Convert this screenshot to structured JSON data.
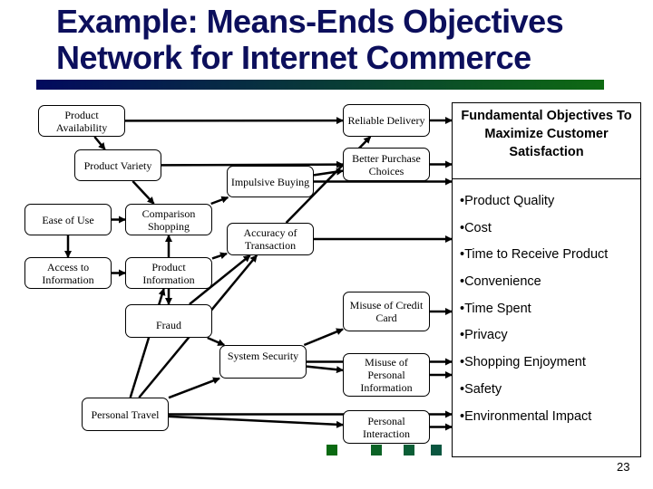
{
  "slide": {
    "title_line1": "Example: Means-Ends Objectives",
    "title_line2": "Network for Internet Commerce",
    "page_number": "23",
    "colors": {
      "title": "#0c0f5c",
      "bar_start": "#020a5e",
      "bar_end": "#0e6a12"
    }
  },
  "nodes": {
    "product_availability": "Product Availability",
    "product_variety": "Product Variety",
    "ease_of_use": "Ease of Use",
    "comparison_shopping": "Comparison Shopping",
    "access_to_information": "Access to Information",
    "product_information": "Product Information",
    "impulsive_buying": "Impulsive Buying",
    "accuracy_of_transaction": "Accuracy of Transaction",
    "reliable_delivery": "Reliable Delivery",
    "better_purchase_choices": "Better Purchase Choices",
    "fraud": "Fraud",
    "system_security": "System Security",
    "misuse_of_credit_card": "Misuse of Credit Card",
    "misuse_of_personal_information": "Misuse of Personal Information",
    "personal_travel": "Personal Travel",
    "personal_interaction": "Personal Interaction"
  },
  "fundamental": {
    "title": "Fundamental Objectives To Maximize Customer Satisfaction",
    "objectives": [
      "•Product Quality",
      "•Cost",
      "•Time to Receive Product",
      "•Convenience",
      "•Time Spent",
      "•Privacy",
      "•Shopping Enjoyment",
      "•Safety",
      "•Environmental Impact"
    ]
  },
  "edges": [
    [
      "product_availability",
      "product_variety"
    ],
    [
      "product_availability",
      "reliable_delivery"
    ],
    [
      "product_variety",
      "comparison_shopping"
    ],
    [
      "product_variety",
      "better_purchase_choices"
    ],
    [
      "ease_of_use",
      "comparison_shopping"
    ],
    [
      "ease_of_use",
      "access_to_information"
    ],
    [
      "access_to_information",
      "product_information"
    ],
    [
      "product_information",
      "comparison_shopping"
    ],
    [
      "product_information",
      "fraud"
    ],
    [
      "comparison_shopping",
      "impulsive_buying"
    ],
    [
      "product_information",
      "accuracy_of_transaction"
    ],
    [
      "impulsive_buying",
      "better_purchase_choices"
    ],
    [
      "impulsive_buying",
      "fundamental"
    ],
    [
      "accuracy_of_transaction",
      "reliable_delivery"
    ],
    [
      "accuracy_of_transaction",
      "fundamental"
    ],
    [
      "fraud",
      "accuracy_of_transaction"
    ],
    [
      "fraud",
      "system_security"
    ],
    [
      "personal_travel",
      "product_information"
    ],
    [
      "personal_travel",
      "accuracy_of_transaction"
    ],
    [
      "personal_travel",
      "system_security"
    ],
    [
      "personal_travel",
      "fundamental"
    ],
    [
      "personal_travel",
      "personal_interaction"
    ],
    [
      "system_security",
      "misuse_of_credit_card"
    ],
    [
      "system_security",
      "misuse_of_personal_information"
    ],
    [
      "system_security",
      "fundamental"
    ],
    [
      "reliable_delivery",
      "fundamental"
    ],
    [
      "better_purchase_choices",
      "fundamental"
    ],
    [
      "misuse_of_credit_card",
      "fundamental"
    ],
    [
      "misuse_of_personal_information",
      "fundamental"
    ],
    [
      "personal_interaction",
      "fundamental"
    ]
  ]
}
